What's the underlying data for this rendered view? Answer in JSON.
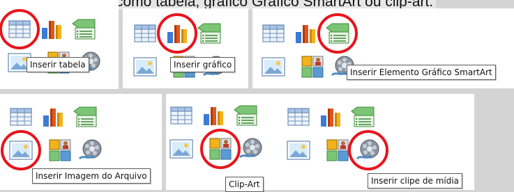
{
  "caption": "clue, como tabela, gráfico Gráfico SmartArt ou clip-art.",
  "tooltips": {
    "table": "Inserir tabela",
    "chart": "Inserir gráfico",
    "smartart": "Inserir Elemento Gráfico SmartArt",
    "picture": "Inserir Imagem do Arquivo",
    "clipart": "Clip-Art",
    "media": "Inserir clipe de mídia"
  },
  "colors": {
    "highlight_circle": "#e8141c",
    "background": "#d4d4d4"
  },
  "icons": [
    "table-icon",
    "chart-icon",
    "smartart-icon",
    "picture-icon",
    "clipart-icon",
    "media-icon"
  ]
}
